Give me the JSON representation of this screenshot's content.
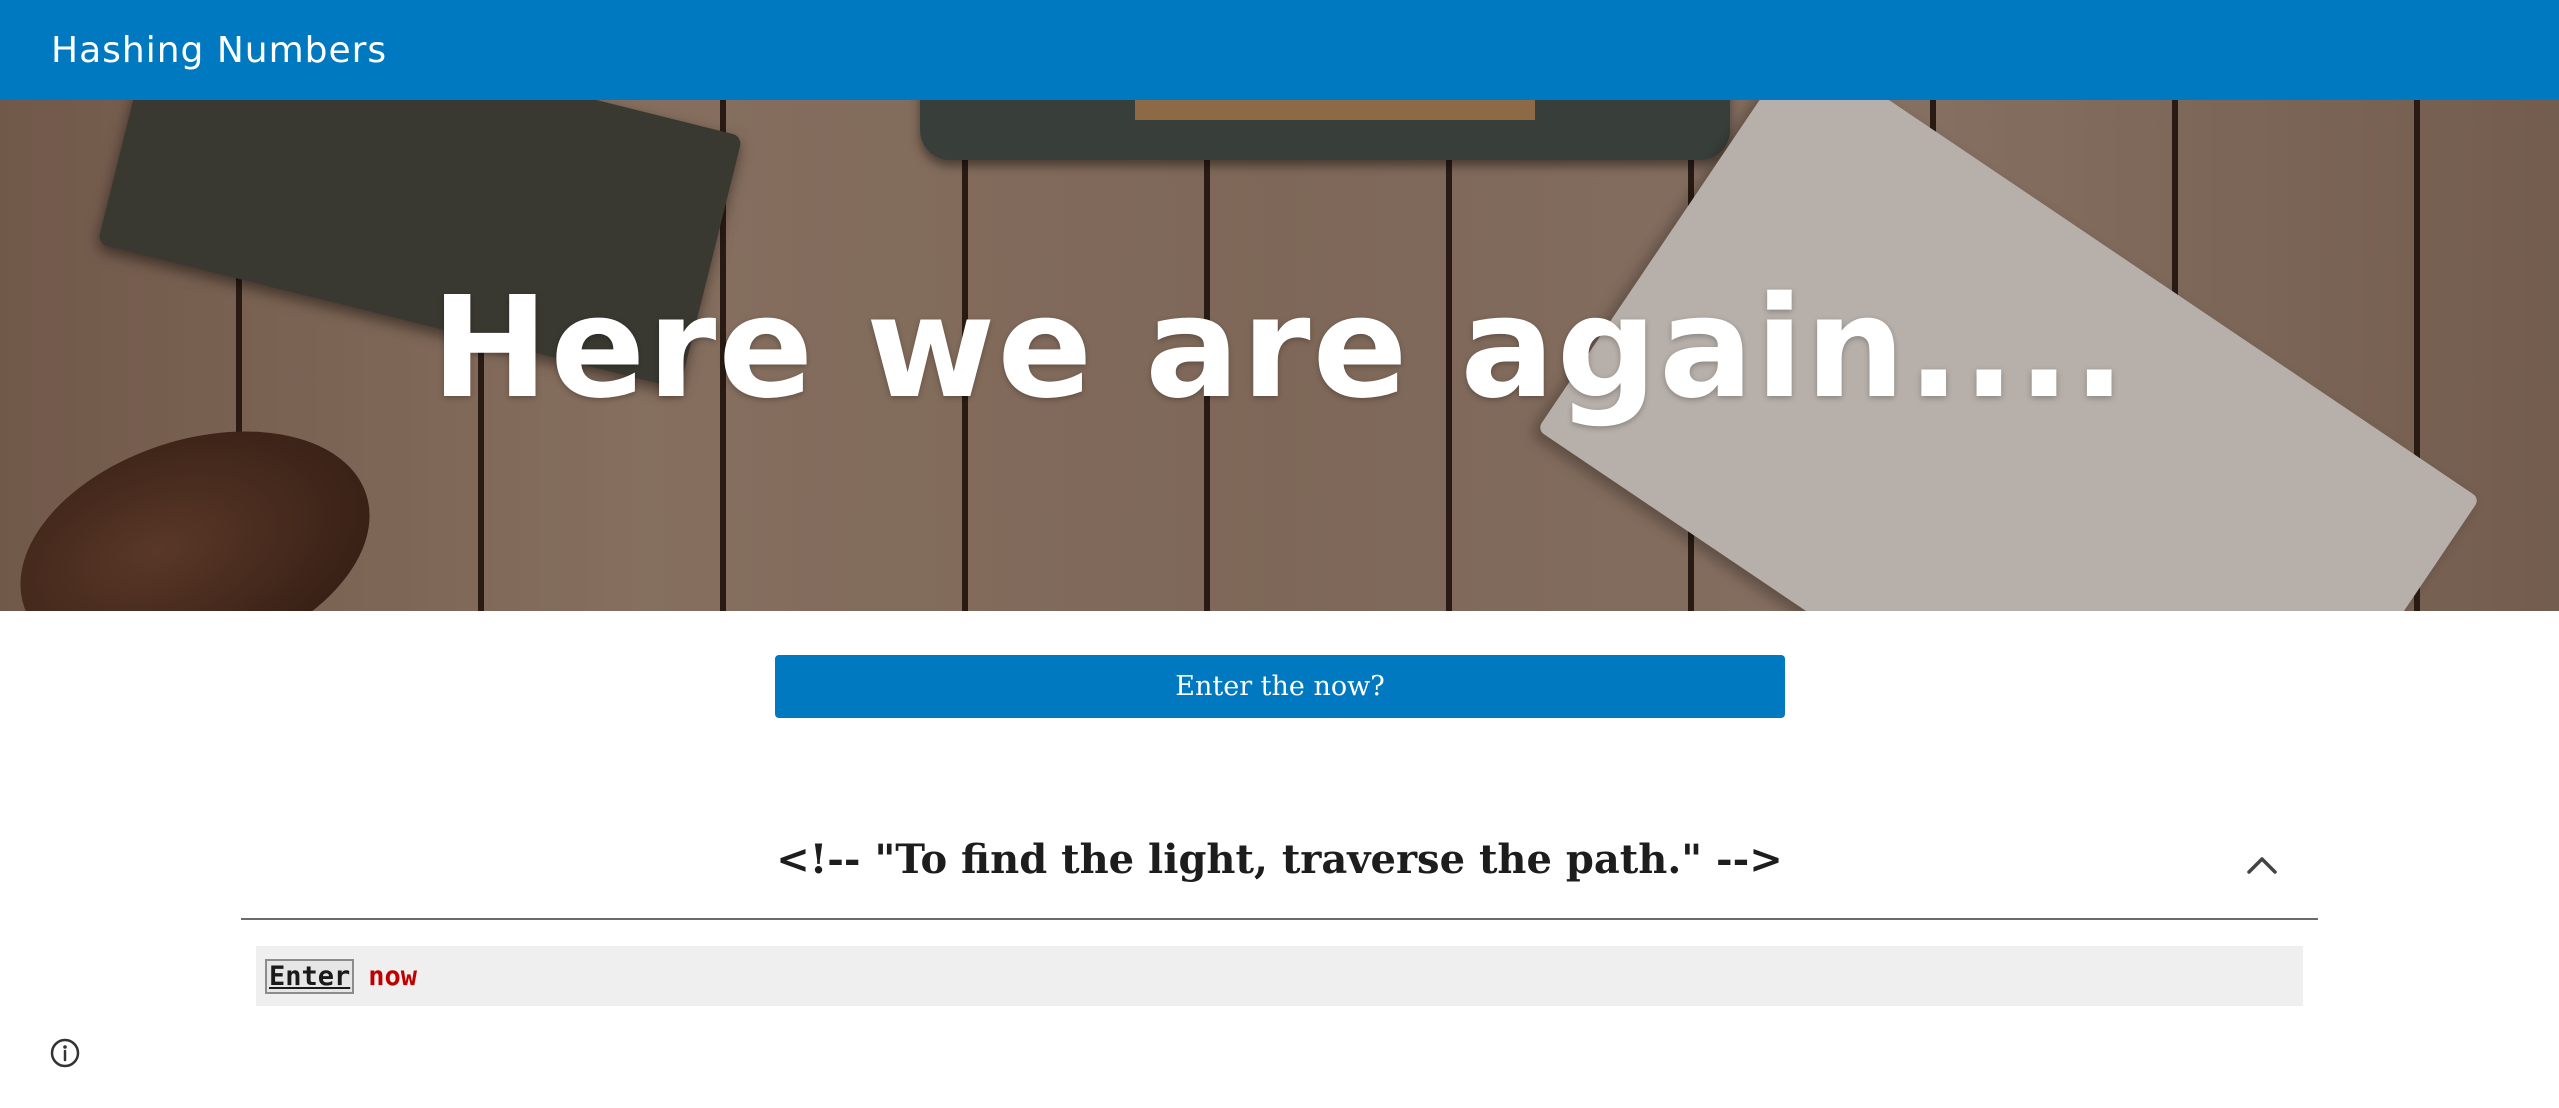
{
  "header": {
    "site_title": "Hashing Numbers"
  },
  "hero": {
    "heading": "Here we are again....",
    "background_description_icon": "wood-desk-photo"
  },
  "main": {
    "enter_button_label": "Enter the now?",
    "section": {
      "title": "<!-- \"To find the light, traverse the path.\" -->",
      "toggle_icon": "chevron-up-icon"
    },
    "code": {
      "link_text": "Enter",
      "keyword_text": "now"
    }
  },
  "footer": {
    "info_icon": "info-icon"
  },
  "colors": {
    "brand_blue": "#0079c1",
    "code_background": "#efefef",
    "keyword_red": "#c00000"
  }
}
